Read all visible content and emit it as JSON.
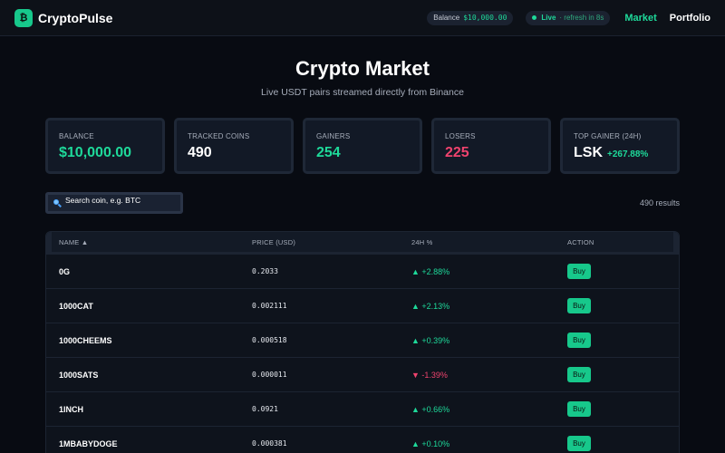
{
  "app": {
    "logo_glyph": "₿",
    "name": "CryptoPulse"
  },
  "topbar": {
    "balance_label": "Balance",
    "balance_value": "$10,000.00",
    "live_label": "Live",
    "refresh_text": "· refresh in 8s",
    "nav": [
      {
        "label": "Market",
        "active": true
      },
      {
        "label": "Portfolio",
        "active": false
      }
    ]
  },
  "header": {
    "title": "Crypto Market",
    "subtitle": "Live USDT pairs streamed directly from Binance"
  },
  "stats": [
    {
      "label": "BALANCE",
      "value": "$10,000.00",
      "tone": "green"
    },
    {
      "label": "TRACKED COINS",
      "value": "490",
      "tone": "white"
    },
    {
      "label": "GAINERS",
      "value": "254",
      "tone": "green"
    },
    {
      "label": "LOSERS",
      "value": "225",
      "tone": "red"
    },
    {
      "label": "TOP GAINER (24H)",
      "value": "LSK",
      "extra": "+267.88%",
      "tone": "white"
    }
  ],
  "search": {
    "placeholder": "Search coin, e.g. BTC",
    "value": "",
    "results": "490 results"
  },
  "table": {
    "headers": {
      "name": "NAME ▲",
      "price": "PRICE (USD)",
      "change": "24H %",
      "action": "ACTION"
    },
    "rows": [
      {
        "name": "0G",
        "price": "0.2033",
        "change": "▲ +2.88%",
        "dir": "up",
        "action": "Buy"
      },
      {
        "name": "1000CAT",
        "price": "0.002111",
        "change": "▲ +2.13%",
        "dir": "up",
        "action": "Buy"
      },
      {
        "name": "1000CHEEMS",
        "price": "0.000518",
        "change": "▲ +0.39%",
        "dir": "up",
        "action": "Buy"
      },
      {
        "name": "1000SATS",
        "price": "0.000011",
        "change": "▼ -1.39%",
        "dir": "down",
        "action": "Buy"
      },
      {
        "name": "1INCH",
        "price": "0.0921",
        "change": "▲ +0.66%",
        "dir": "up",
        "action": "Buy"
      },
      {
        "name": "1MBABYDOGE",
        "price": "0.000381",
        "change": "▲ +0.10%",
        "dir": "up",
        "action": "Buy"
      }
    ]
  },
  "colors": {
    "accent": "#1ed99a",
    "negative": "#f0436e",
    "background": "#080b12",
    "card": "#121926"
  }
}
